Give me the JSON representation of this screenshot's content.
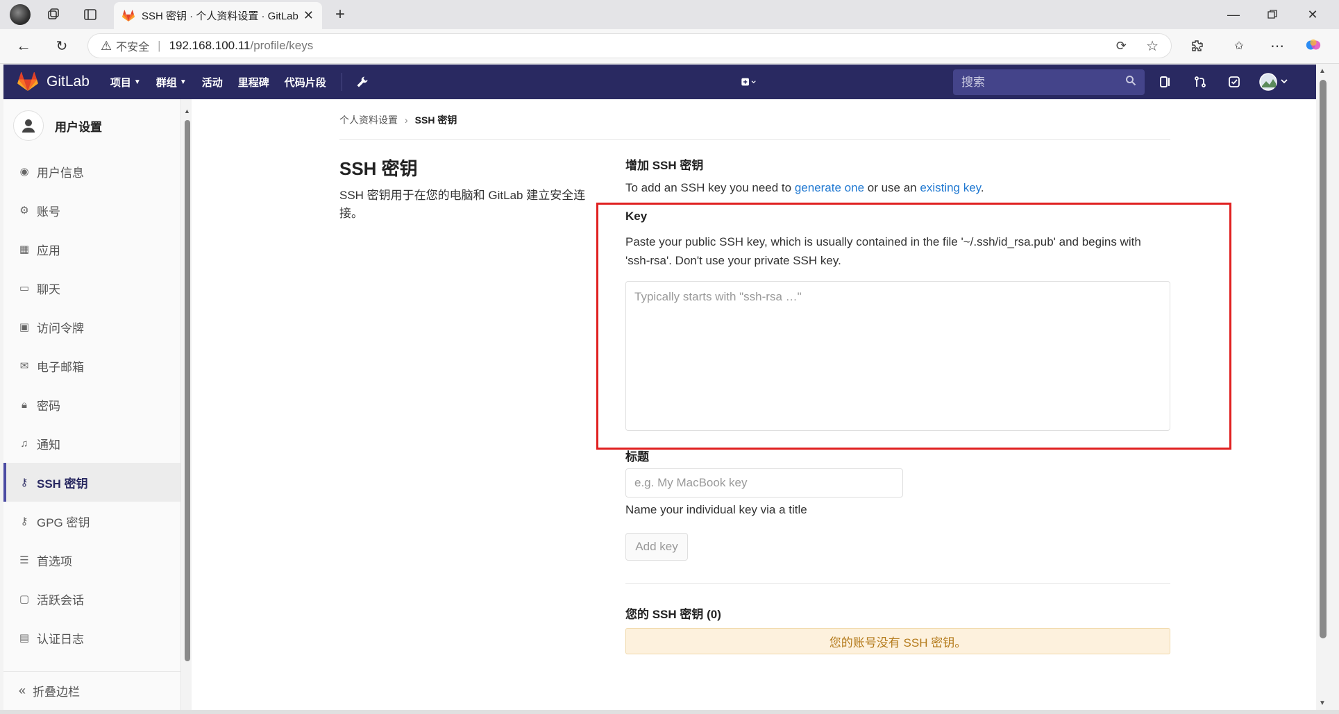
{
  "browser": {
    "tab_title": "SSH 密钥 · 个人资料设置 · GitLab",
    "address_insecure": "不安全",
    "address_host": "192.168.100.11",
    "address_path": "/profile/keys"
  },
  "navbar": {
    "brand": "GitLab",
    "items": [
      {
        "label": "项目",
        "dropdown": true
      },
      {
        "label": "群组",
        "dropdown": true
      },
      {
        "label": "活动",
        "dropdown": false
      },
      {
        "label": "里程碑",
        "dropdown": false
      },
      {
        "label": "代码片段",
        "dropdown": false
      }
    ],
    "search_placeholder": "搜索",
    "bg_color": "#292961"
  },
  "sidebar": {
    "title": "用户设置",
    "items": [
      {
        "label": "用户信息",
        "icon": "user-circle-icon"
      },
      {
        "label": "账号",
        "icon": "user-gear-icon"
      },
      {
        "label": "应用",
        "icon": "grid-icon"
      },
      {
        "label": "聊天",
        "icon": "chat-icon"
      },
      {
        "label": "访问令牌",
        "icon": "token-icon"
      },
      {
        "label": "电子邮箱",
        "icon": "mail-icon"
      },
      {
        "label": "密码",
        "icon": "lock-icon"
      },
      {
        "label": "通知",
        "icon": "bell-icon"
      },
      {
        "label": "SSH 密钥",
        "icon": "key-icon",
        "active": true
      },
      {
        "label": "GPG 密钥",
        "icon": "key-icon"
      },
      {
        "label": "首选项",
        "icon": "sliders-icon"
      },
      {
        "label": "活跃会话",
        "icon": "monitor-icon"
      },
      {
        "label": "认证日志",
        "icon": "list-icon"
      }
    ],
    "collapse_label": "折叠边栏"
  },
  "main": {
    "breadcrumb": {
      "parent": "个人资料设置",
      "current": "SSH 密钥"
    },
    "title": "SSH 密钥",
    "description": "SSH 密钥用于在您的电脑和 GitLab 建立安全连接。",
    "add_heading": "增加 SSH 密钥",
    "add_text_1": "To add an SSH key you need to ",
    "add_link_1": "generate one",
    "add_text_2": " or use an ",
    "add_link_2": "existing key",
    "add_text_3": ".",
    "key_label": "Key",
    "key_help_1": "Paste your public SSH key, which is usually contained in the file '~/.ssh/id_rsa.pub' and begins with",
    "key_help_2": "'ssh-rsa'. Don't use your private SSH key.",
    "key_placeholder": "Typically starts with \"ssh-rsa …\"",
    "title_label": "标题",
    "title_placeholder": "e.g. My MacBook key",
    "title_help": "Name your individual key via a title",
    "add_button": "Add key",
    "your_keys_heading": "您的 SSH 密钥 (0)",
    "empty_notice": "您的账号没有 SSH 密钥。"
  }
}
